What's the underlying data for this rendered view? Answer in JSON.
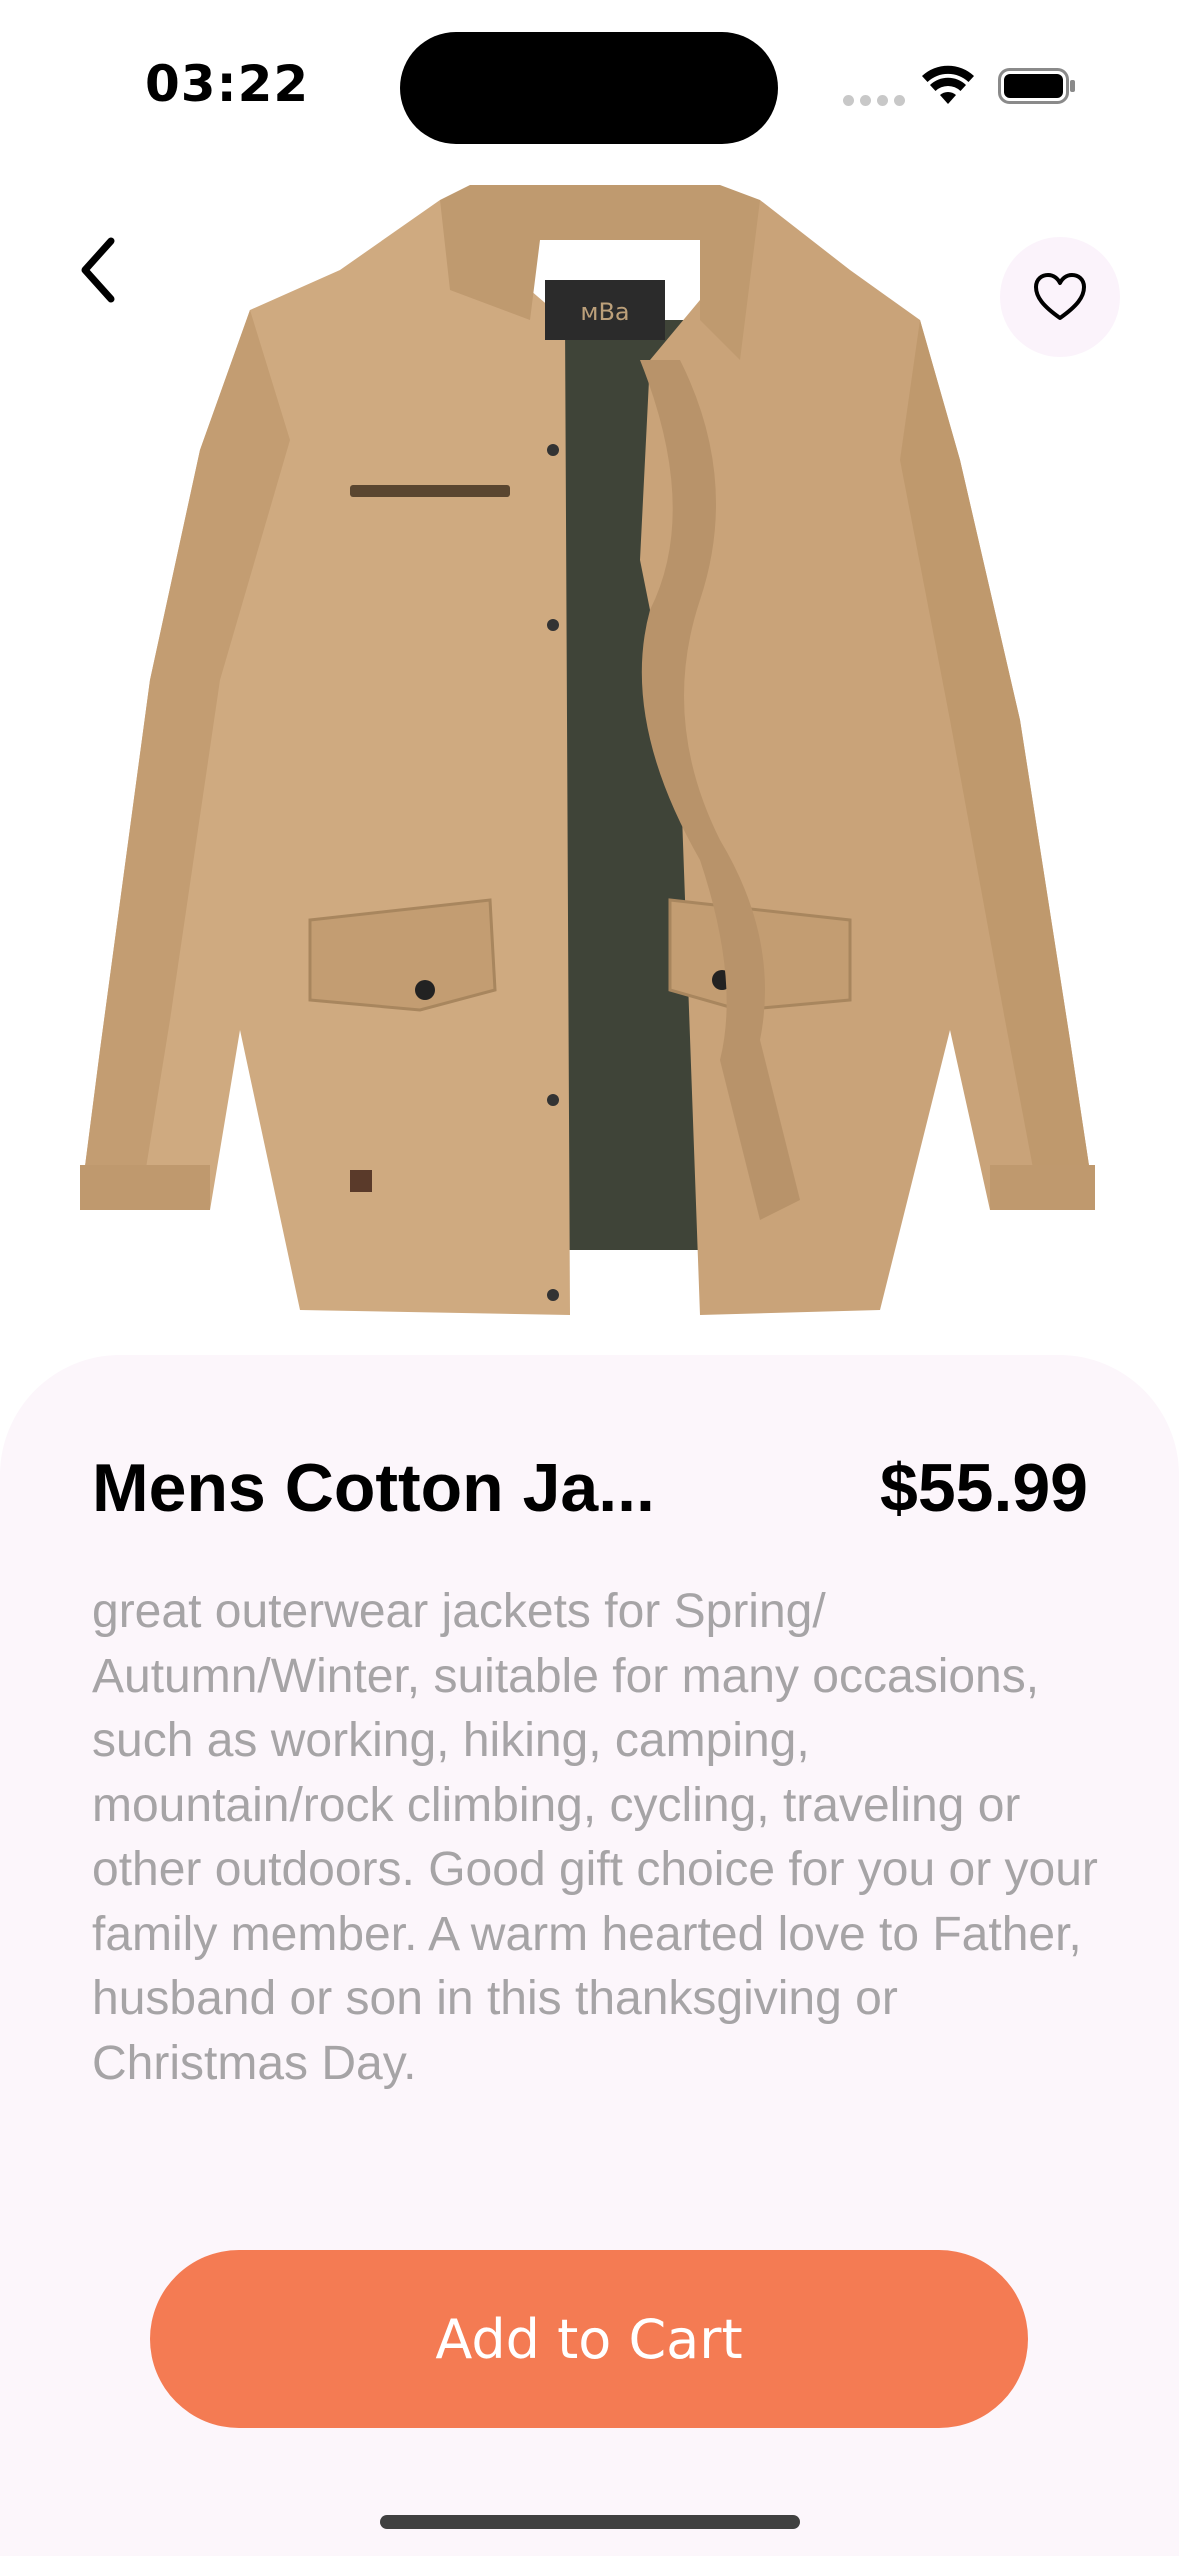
{
  "status_bar": {
    "time": "03:22"
  },
  "product": {
    "title": "Mens Cotton Ja...",
    "price": "$55.99",
    "description": "great outerwear jackets for Spring/ Autumn/Winter, suitable for many occasions, such as working, hiking, camping, mountain/rock climbing, cycling, traveling or other outdoors. Good gift choice for you or your family member. A warm hearted love to Father, husband or son in this thanksgiving or Christmas Day.",
    "image_label": "jacket product photo"
  },
  "actions": {
    "add_to_cart_label": "Add to Cart",
    "back_icon": "chevron-left-icon",
    "favorite_icon": "heart-icon"
  },
  "colors": {
    "accent": "#f47b53",
    "sheet_background": "#fcf6fb",
    "description_text": "#a6a4a6",
    "favorite_bg": "#fbf3fb"
  }
}
